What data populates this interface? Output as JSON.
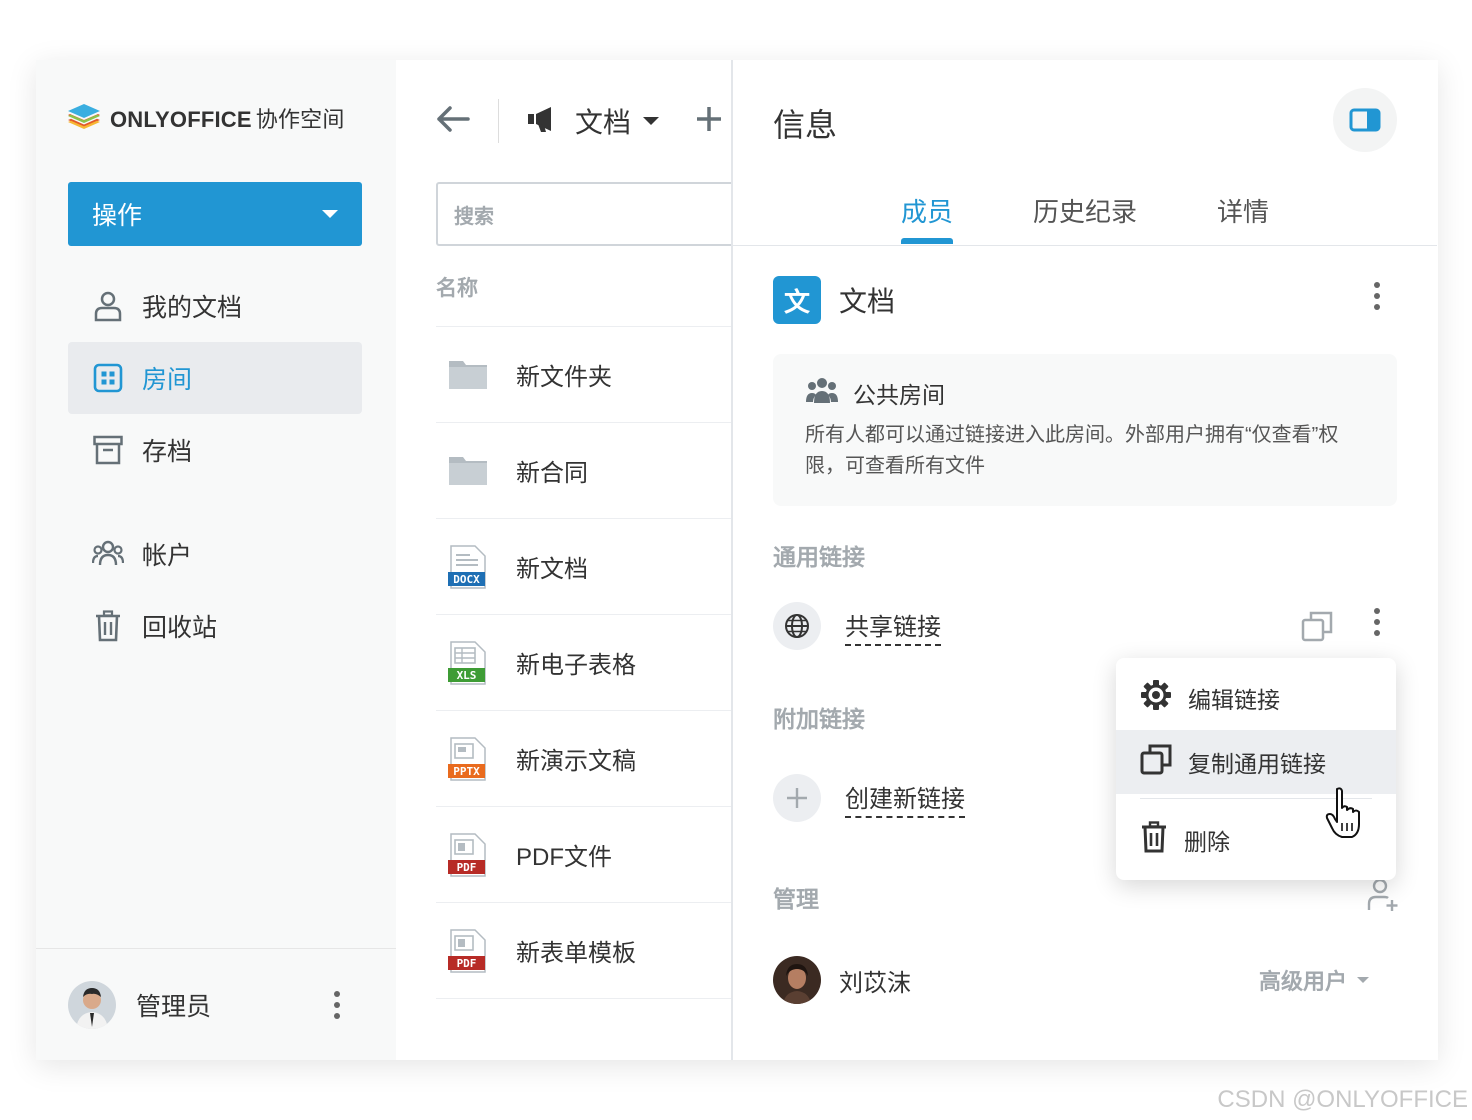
{
  "app": {
    "logo_brand": "ONLYOFFICE",
    "logo_suffix": "协作空间"
  },
  "sidebar": {
    "actions_label": "操作",
    "items": [
      {
        "label": "我的文档",
        "icon": "user-icon"
      },
      {
        "label": "房间",
        "icon": "rooms-icon",
        "active": true
      },
      {
        "label": "存档",
        "icon": "archive-icon"
      },
      {
        "label": "帐户",
        "icon": "accounts-icon"
      },
      {
        "label": "回收站",
        "icon": "trash-icon"
      }
    ],
    "user_name": "管理员"
  },
  "files": {
    "folder_title": "文档",
    "search_placeholder": "搜索",
    "column_name": "名称",
    "rows": [
      {
        "name": "新文件夹",
        "type": "folder"
      },
      {
        "name": "新合同",
        "type": "folder"
      },
      {
        "name": "新文档",
        "type": "DOCX"
      },
      {
        "name": "新电子表格",
        "type": "XLS"
      },
      {
        "name": "新演示文稿",
        "type": "PPTX"
      },
      {
        "name": "PDF文件",
        "type": "PDF"
      },
      {
        "name": "新表单模板",
        "type": "PDF"
      }
    ]
  },
  "info": {
    "title": "信息",
    "tabs": [
      "成员",
      "历史纪录",
      "详情"
    ],
    "room_badge": "文",
    "room_name": "文档",
    "notice_title": "公共房间",
    "notice_text": "所有人都可以通过链接进入此房间。外部用户拥有“仅查看”权限，可查看所有文件",
    "general_links_label": "通用链接",
    "shared_link": "共享链接",
    "additional_links_label": "附加链接",
    "create_link": "创建新链接",
    "admin_label": "管理",
    "member_name": "刘苡沫",
    "member_role": "高级用户"
  },
  "context_menu": {
    "items": [
      "编辑链接",
      "复制通用链接",
      "删除"
    ]
  },
  "watermark": "CSDN @ONLYOFFICE",
  "colors": {
    "accent": "#2196d3",
    "docx": "#1e6fb4",
    "xls": "#3e9c35",
    "pptx": "#e96b1e",
    "pdf": "#b72b26"
  }
}
